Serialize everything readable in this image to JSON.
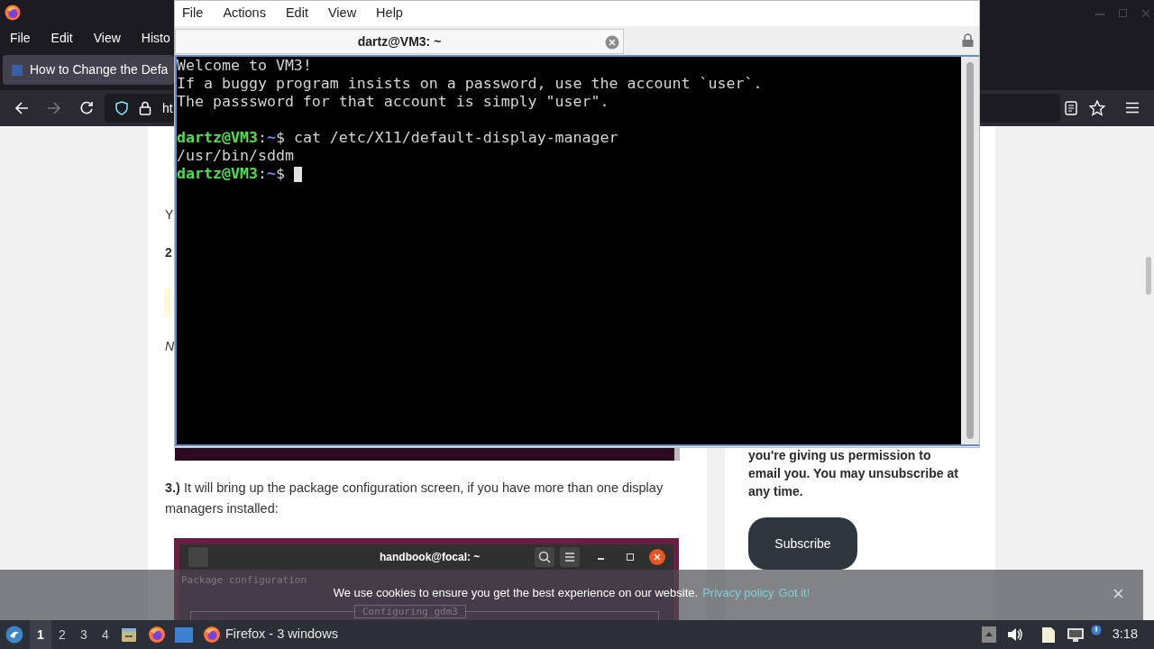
{
  "browser": {
    "menu": [
      "File",
      "Edit",
      "View",
      "Histo"
    ],
    "tab": {
      "title": "How to Change the Defa",
      "selected": true
    },
    "url": "ht",
    "article": {
      "fragments": [
        {
          "kind": "text",
          "text": "Y"
        },
        {
          "kind": "heading",
          "text": "2"
        },
        {
          "kind": "italic",
          "text": "N"
        }
      ],
      "step": "**3.)** It will bring up the package configuration screen, if you have more than one display managers installed:",
      "screenshot": {
        "title": "handbook@focal: ~",
        "header": "Package configuration",
        "dialog": "Configuring gdm3"
      }
    },
    "sidebar": {
      "note": "you're giving us permission to email you. You may unsubscribe at any time.",
      "button": "Subscribe"
    },
    "cookie_bar": {
      "message": "We use cookies to ensure you get the best experience on our website.",
      "links": [
        "Privacy policy",
        "Got it!"
      ],
      "close": "×"
    }
  },
  "terminal": {
    "menu": [
      "File",
      "Actions",
      "Edit",
      "View",
      "Help"
    ],
    "tab": {
      "title": "dartz@VM3: ~",
      "selected": true
    },
    "lines": [
      {
        "kind": "text",
        "text": "Welcome to VM3!"
      },
      {
        "kind": "text",
        "text": "If a buggy program insists on a password, use the account `user`."
      },
      {
        "kind": "text",
        "text": "The passsword for that account is simply \"user\"."
      },
      {
        "kind": "blank"
      },
      {
        "kind": "prompt",
        "user": "dartz@VM3",
        "separator": ":",
        "path": "~",
        "symbol": "$",
        "command": "cat /etc/X11/default-display-manager",
        "cursor": false
      },
      {
        "kind": "text",
        "text": "/usr/bin/sddm"
      },
      {
        "kind": "prompt",
        "user": "dartz@VM3",
        "separator": ":",
        "path": "~",
        "symbol": "$",
        "cursor": true
      }
    ]
  },
  "taskbar": {
    "workspaces": [
      {
        "label": "1",
        "selected": true
      },
      {
        "label": "2",
        "selected": false
      },
      {
        "label": "3",
        "selected": false
      },
      {
        "label": "4",
        "selected": false
      }
    ],
    "window_button": "Firefox - 3 windows",
    "clock": "3:18"
  }
}
